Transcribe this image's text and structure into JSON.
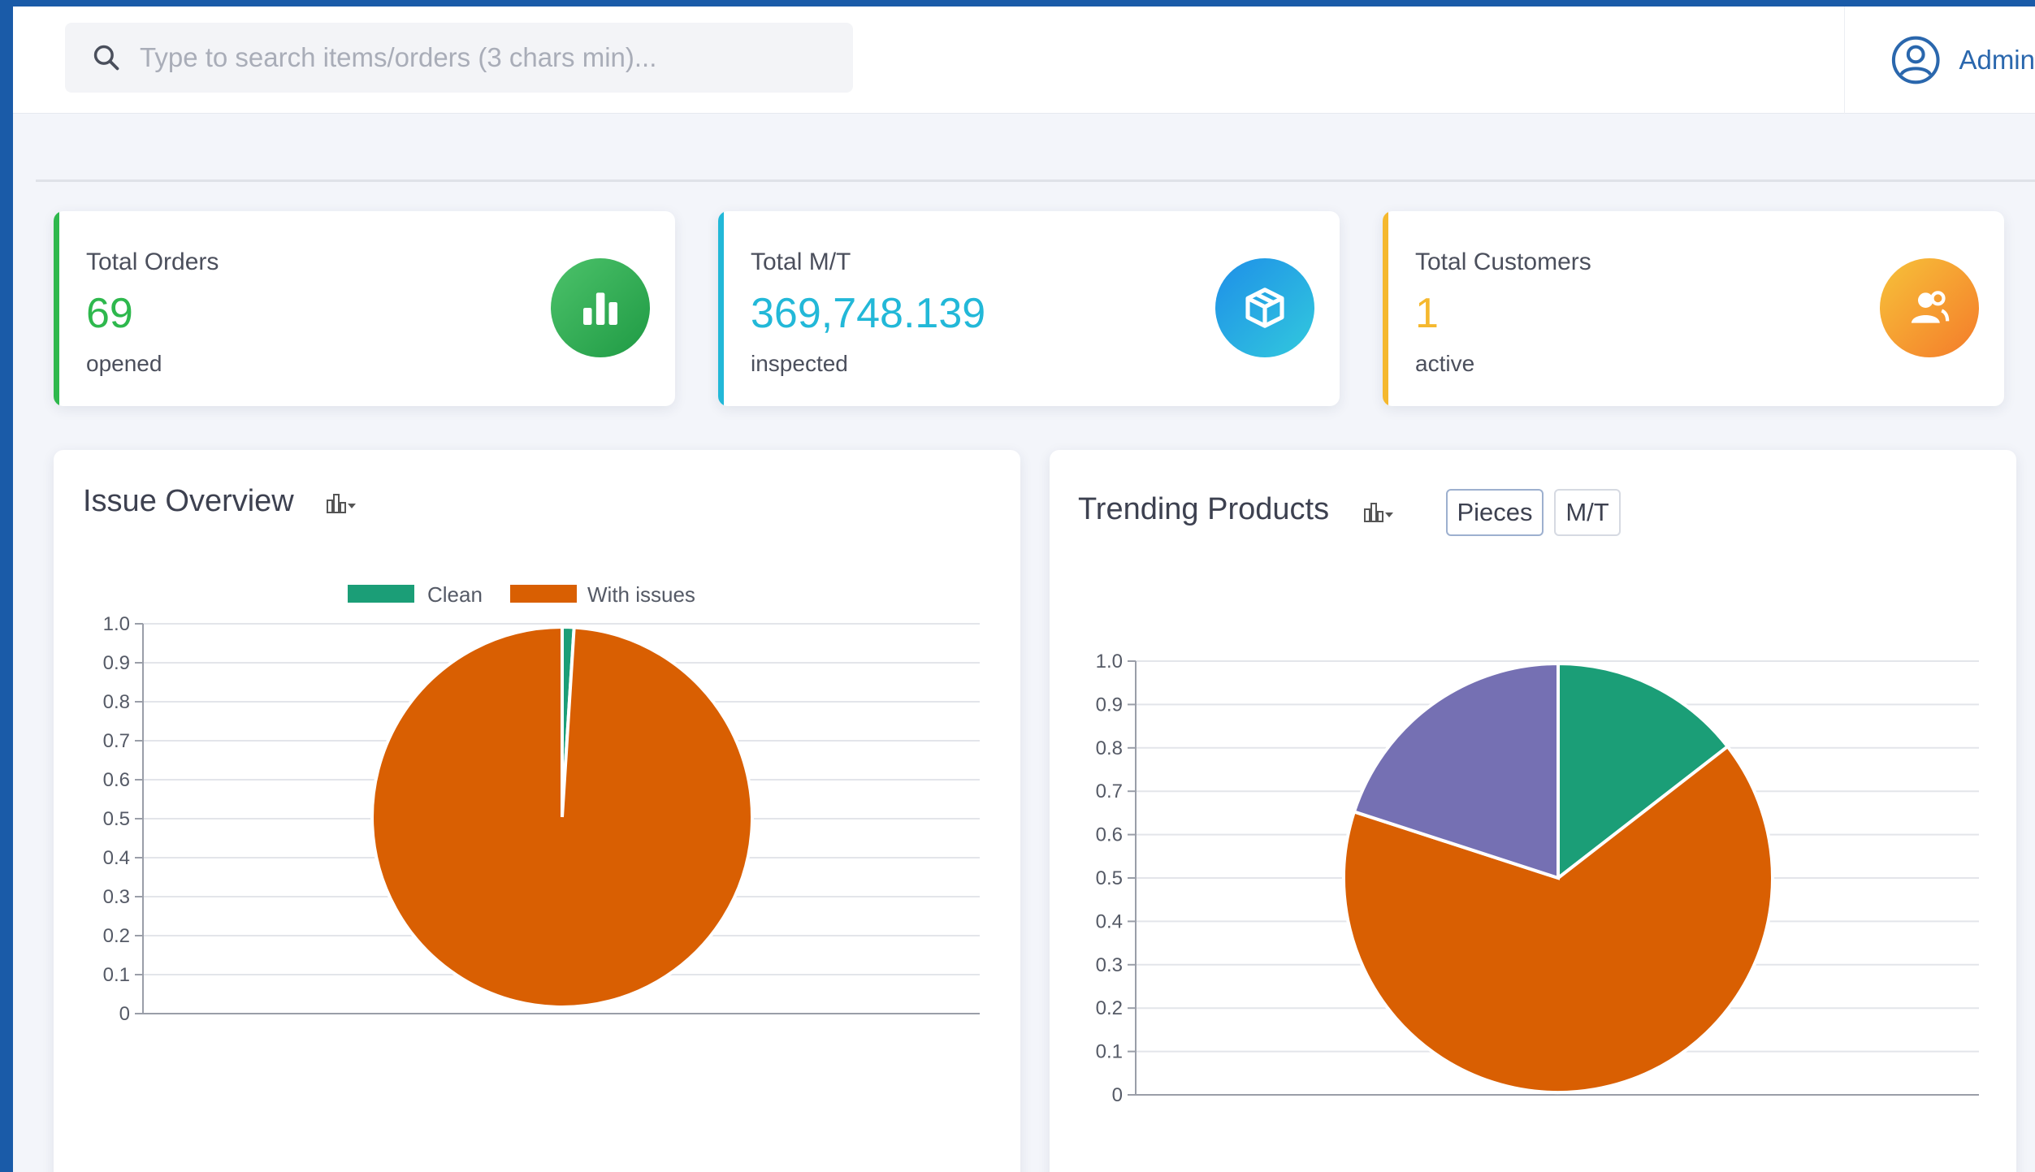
{
  "search": {
    "placeholder": "Type to search items/orders (3 chars min)..."
  },
  "user": {
    "name": "Admin"
  },
  "stats": [
    {
      "label": "Total Orders",
      "value": "69",
      "sub": "opened",
      "color": "#2eb84d",
      "icon": "bar-chart-icon"
    },
    {
      "label": "Total M/T",
      "value": "369,748.139",
      "sub": "inspected",
      "color": "#22b8d8",
      "icon": "box-icon"
    },
    {
      "label": "Total Customers",
      "value": "1",
      "sub": "active",
      "color": "#f5b82e",
      "icon": "users-icon"
    }
  ],
  "issue_panel": {
    "title": "Issue Overview",
    "icon": "chart-type-dropdown-icon"
  },
  "trending_panel": {
    "title": "Trending Products",
    "icon": "chart-type-dropdown-icon",
    "toggle_pieces": "Pieces",
    "toggle_mt": "M/T",
    "active_toggle": "Pieces"
  },
  "chart_data": [
    {
      "type": "pie",
      "title": "",
      "legend_position": "top",
      "labels": [
        "Clean",
        "With issues"
      ],
      "values": [
        0.01,
        0.99
      ],
      "colors": [
        "#1b9e77",
        "#d95f02"
      ],
      "yticks": [
        "1.0",
        "0.9",
        "0.8",
        "0.7",
        "0.6",
        "0.5",
        "0.4",
        "0.3",
        "0.2",
        "0.1",
        "0"
      ],
      "grid": true
    },
    {
      "type": "pie",
      "title": "",
      "labels": [
        "",
        "",
        ""
      ],
      "values": [
        0.145,
        0.655,
        0.2
      ],
      "colors": [
        "#1b9e77",
        "#d95f02",
        "#7570b3"
      ],
      "yticks": [
        "1.0",
        "0.9",
        "0.8",
        "0.7",
        "0.6",
        "0.5",
        "0.4",
        "0.3",
        "0.2",
        "0.1",
        "0"
      ],
      "grid": true
    }
  ]
}
